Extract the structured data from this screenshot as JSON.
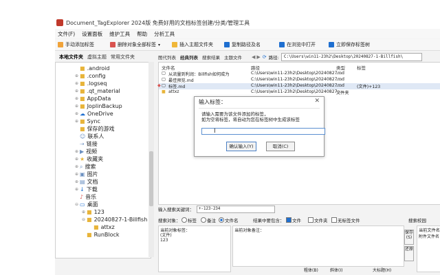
{
  "window": {
    "title": "Document_TagExplorer 2024版 免费好用的文档标签创建/分类/管理工具"
  },
  "menu": [
    "文件(F)",
    "设置面板",
    "维护工具",
    "帮助",
    "分析工具"
  ],
  "toolbar": {
    "items": [
      {
        "label": "手动添加标签",
        "icon": "tag-icon",
        "color": "#f0a33a"
      },
      {
        "label": "删除对象全部标签",
        "icon": "tag-delete-icon",
        "color": "#d9534f"
      },
      {
        "label": "插入主题文件夹",
        "icon": "folder-add-icon",
        "color": "#f0b73a"
      },
      {
        "label": "复制路径及名",
        "icon": "copy-icon",
        "color": "#1f6fd0"
      },
      {
        "label": "在浏览中打开",
        "icon": "open-icon",
        "color": "#1f6fd0"
      },
      {
        "label": "立即保存标签树",
        "icon": "save-icon",
        "color": "#1f6fd0"
      }
    ]
  },
  "left_tabs": [
    "本地文件夹",
    "虚拟主题",
    "常用文件夹"
  ],
  "tree": [
    {
      "label": ".android",
      "icon": "folder-icon",
      "exp": "",
      "indent": 2
    },
    {
      "label": ".config",
      "icon": "folder-icon",
      "exp": "⊕",
      "indent": 2
    },
    {
      "label": ".logseq",
      "icon": "folder-icon",
      "exp": "⊕",
      "indent": 2
    },
    {
      "label": ".qt_material",
      "icon": "folder-icon",
      "exp": "⊕",
      "indent": 2
    },
    {
      "label": "AppData",
      "icon": "folder-icon",
      "exp": "⊕",
      "indent": 2
    },
    {
      "label": "JoplinBackup",
      "icon": "folder-icon",
      "exp": "⊕",
      "indent": 2
    },
    {
      "label": "OneDrive",
      "icon": "cloud-icon",
      "exp": "⊕",
      "indent": 2
    },
    {
      "label": "Sync",
      "icon": "folder-icon",
      "exp": "⊕",
      "indent": 2
    },
    {
      "label": "保存的游戏",
      "icon": "folder-icon",
      "exp": "",
      "indent": 2
    },
    {
      "label": "联系人",
      "icon": "contacts-icon",
      "exp": "",
      "indent": 2
    },
    {
      "label": "链接",
      "icon": "link-icon",
      "exp": "",
      "indent": 2
    },
    {
      "label": "视频",
      "icon": "video-icon",
      "exp": "⊕",
      "indent": 2
    },
    {
      "label": "收藏夹",
      "icon": "star-folder-icon",
      "exp": "⊕",
      "indent": 2
    },
    {
      "label": "搜索",
      "icon": "search-folder-icon",
      "exp": "⊕",
      "indent": 2
    },
    {
      "label": "图片",
      "icon": "pictures-icon",
      "exp": "⊕",
      "indent": 2
    },
    {
      "label": "文档",
      "icon": "documents-icon",
      "exp": "⊕",
      "indent": 2
    },
    {
      "label": "下载",
      "icon": "download-icon",
      "exp": "⊕",
      "indent": 2
    },
    {
      "label": "音乐",
      "icon": "music-icon",
      "exp": "",
      "indent": 2
    },
    {
      "label": "桌面",
      "icon": "desktop-icon",
      "exp": "⊖",
      "indent": 2
    },
    {
      "label": "123",
      "icon": "folder-icon",
      "exp": "⊕",
      "indent": 3
    },
    {
      "label": "20240827-1-Billfish",
      "icon": "folder-icon",
      "exp": "⊖",
      "indent": 3
    },
    {
      "label": "attxz",
      "icon": "folder-icon",
      "exp": "",
      "indent": 4
    },
    {
      "label": "RunBlock",
      "icon": "folder-icon",
      "exp": "",
      "indent": 3
    }
  ],
  "right_tabs": [
    "图代列表",
    "经典列表",
    "搜索结果",
    "主题文件"
  ],
  "address": {
    "label": "路径:",
    "value": "C:\\Users\\win11-23h2\\Desktop\\20240827-1-Billfish\\"
  },
  "file_list": {
    "headers": [
      "文件名",
      "路径",
      "类型",
      "标签"
    ],
    "rows": [
      {
        "name": "从流量到利润：Billfish如何成为",
        "path": "C:\\Users\\win11-23h2\\Desktop\\20240827...",
        "type": ".md",
        "tag": ""
      },
      {
        "name": "最佳预览.md",
        "path": "C:\\Users\\win11-23h2\\Desktop\\20240827...",
        "type": ".md",
        "tag": ""
      },
      {
        "name": "标签.md",
        "path": "C:\\Users\\win11-23h2\\Desktop\\20240827...",
        "type": ".md",
        "tag": "(文件)+123"
      },
      {
        "name": "attxz",
        "path": "C:\\Users\\win11-23h2\\Desktop\\20240827...",
        "type": "文件夹",
        "tag": ""
      }
    ]
  },
  "search": {
    "keyword_label": "输入搜索关键词：",
    "keyword_value": "+-123-234",
    "target_label": "搜索对象：",
    "target_tag": "标签",
    "target_note": "备注",
    "target_filename": "文件名",
    "scope_label": "结果中要包含：",
    "scope_file": "文件",
    "scope_folder": "文件夹",
    "scope_untagged": "无标签文件",
    "history_label": "搜索校园",
    "current_tags_label": "当前对象标签：",
    "current_tags_value": "(文件)\n123",
    "current_notes_label": "当前对象备注：",
    "side_buttons": [
      "保存",
      "(S)",
      "还原"
    ],
    "bottom_buttons": [
      "粗体(B)",
      "斜体(I)",
      "大标题(H)"
    ],
    "right_panel_label": "当前文件名",
    "right_panel_value": "附件文件名"
  },
  "dialog": {
    "title": "输入标签：",
    "prompt": "请输入需要为该文件添加的标签，\n如为空将标签，将自动为您在标签树中生成该标签",
    "input_value": "",
    "ok_label": "确认输入(Y)",
    "cancel_label": "取消(C)"
  }
}
